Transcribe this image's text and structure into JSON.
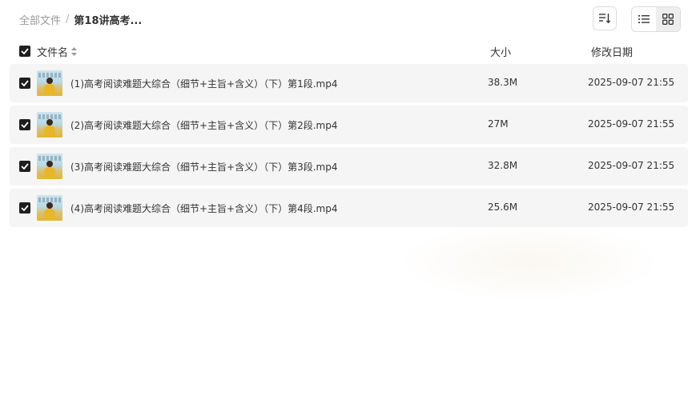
{
  "breadcrumb": {
    "root": "全部文件",
    "separator": "/",
    "current": "第18讲高考..."
  },
  "toolbar": {
    "sort_icon": "sort-icon",
    "list_view_icon": "list-view-icon",
    "grid_view_icon": "grid-view-icon",
    "active_view": "grid"
  },
  "table": {
    "headers": {
      "name": "文件名",
      "size": "大小",
      "date": "修改日期"
    },
    "all_selected": true,
    "rows": [
      {
        "name": "(1)高考阅读难题大综合（细节+主旨+含义）（下）第1段.mp4",
        "size": "38.3M",
        "date": "2025-09-07 21:55",
        "checked": true
      },
      {
        "name": "(2)高考阅读难题大综合（细节+主旨+含义）（下）第2段.mp4",
        "size": "27M",
        "date": "2025-09-07 21:55",
        "checked": true
      },
      {
        "name": "(3)高考阅读难题大综合（细节+主旨+含义）（下）第3段.mp4",
        "size": "32.8M",
        "date": "2025-09-07 21:55",
        "checked": true
      },
      {
        "name": "(4)高考阅读难题大综合（细节+主旨+含义）（下）第4段.mp4",
        "size": "25.6M",
        "date": "2025-09-07 21:55",
        "checked": true
      }
    ]
  },
  "colors": {
    "row_background": "#f5f5f5",
    "checkbox": "#1f1f1f",
    "muted_text": "#999999",
    "text": "#333333"
  }
}
